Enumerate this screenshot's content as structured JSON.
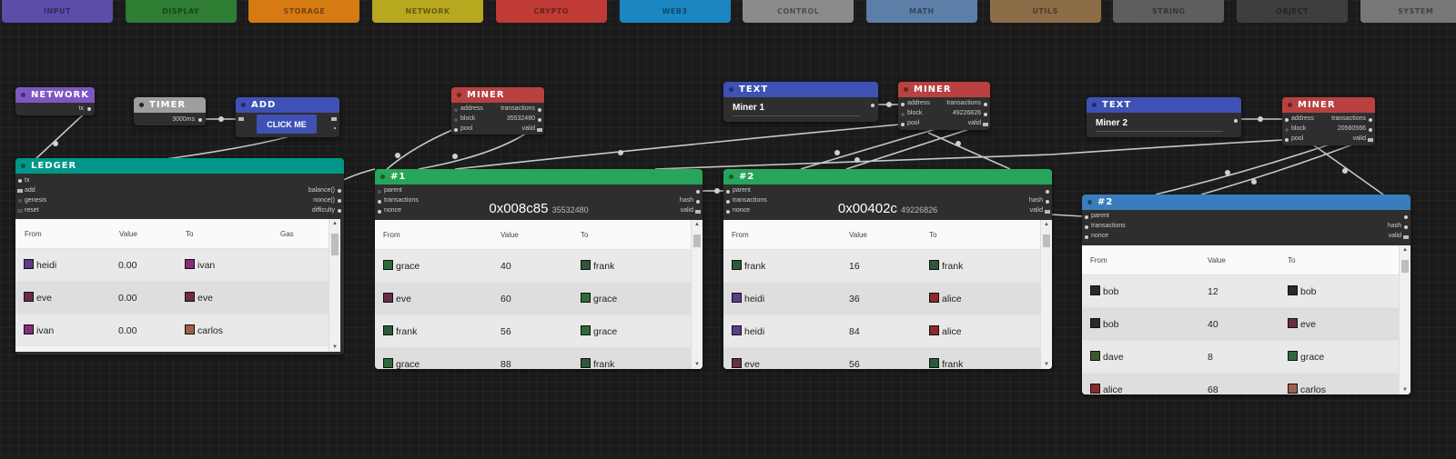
{
  "categories": [
    {
      "label": "INPUT",
      "color": "#5c4ea8"
    },
    {
      "label": "DISPLAY",
      "color": "#2e7d32"
    },
    {
      "label": "STORAGE",
      "color": "#d67a14"
    },
    {
      "label": "NETWORK",
      "color": "#b7a81f"
    },
    {
      "label": "CRYPTO",
      "color": "#c03a36"
    },
    {
      "label": "WEB3",
      "color": "#1b86c2"
    },
    {
      "label": "CONTROL",
      "color": "#8b8b8b"
    },
    {
      "label": "MATH",
      "color": "#5d7ea6"
    },
    {
      "label": "UTILS",
      "color": "#8c6d48"
    },
    {
      "label": "STRING",
      "color": "#5e5e5e"
    },
    {
      "label": "OBJECT",
      "color": "#3e3e3e"
    },
    {
      "label": "SYSTEM",
      "color": "#777777"
    }
  ],
  "network": {
    "title": "NETWORK",
    "port_tx": "tx"
  },
  "timer": {
    "title": "TIMER",
    "value": "3000ms"
  },
  "add": {
    "title": "ADD",
    "button": "CLICK ME"
  },
  "ledger": {
    "title": "LEDGER",
    "inputs": [
      "tx",
      "add",
      "genesis",
      "reset"
    ],
    "outputs": [
      "balance()",
      "nonce()",
      "difficulty"
    ],
    "columns": [
      "From",
      "Value",
      "To",
      "Gas"
    ],
    "rows": [
      {
        "from": "heidi",
        "value": "0.00",
        "to": "ivan"
      },
      {
        "from": "eve",
        "value": "0.00",
        "to": "eve"
      },
      {
        "from": "ivan",
        "value": "0.00",
        "to": "carlos"
      }
    ]
  },
  "miner1": {
    "title": "MINER",
    "address": "address",
    "block": "block",
    "block_val": "35532480",
    "pool": "pool",
    "transactions": "transactions",
    "valid": "valid"
  },
  "miner2": {
    "title": "MINER",
    "address": "address",
    "block": "block",
    "block_val": "49226826",
    "pool": "pool",
    "transactions": "transactions",
    "valid": "valid"
  },
  "miner3": {
    "title": "MINER",
    "address": "address",
    "block": "block",
    "block_val": "20560566",
    "pool": "pool",
    "transactions": "transactions",
    "valid": "valid"
  },
  "text1": {
    "title": "TEXT",
    "value": "Miner 1"
  },
  "text2": {
    "title": "TEXT",
    "value": "Miner 2"
  },
  "block1": {
    "title": "#1",
    "hash": "0x008c85",
    "nonce": "35532480",
    "inputs": [
      "parent",
      "transactions",
      "nonce"
    ],
    "outputs": [
      "hash",
      "valid"
    ],
    "columns": [
      "From",
      "Value",
      "To"
    ],
    "rows": [
      {
        "from": "grace",
        "value": "40",
        "to": "frank"
      },
      {
        "from": "eve",
        "value": "60",
        "to": "grace"
      },
      {
        "from": "frank",
        "value": "56",
        "to": "grace"
      },
      {
        "from": "grace",
        "value": "88",
        "to": "frank"
      }
    ]
  },
  "block2": {
    "title": "#2",
    "hash": "0x00402c",
    "nonce": "49226826",
    "inputs": [
      "parent",
      "transactions",
      "nonce"
    ],
    "outputs": [
      "hash",
      "valid"
    ],
    "columns": [
      "From",
      "Value",
      "To"
    ],
    "rows": [
      {
        "from": "frank",
        "value": "16",
        "to": "frank"
      },
      {
        "from": "heidi",
        "value": "36",
        "to": "alice"
      },
      {
        "from": "heidi",
        "value": "84",
        "to": "alice"
      },
      {
        "from": "eve",
        "value": "56",
        "to": "frank"
      }
    ]
  },
  "block3": {
    "title": "#2",
    "inputs": [
      "parent",
      "transactions",
      "nonce"
    ],
    "outputs": [
      "hash",
      "valid"
    ],
    "columns": [
      "From",
      "Value",
      "To"
    ],
    "rows": [
      {
        "from": "bob",
        "value": "12",
        "to": "bob"
      },
      {
        "from": "bob",
        "value": "40",
        "to": "eve"
      },
      {
        "from": "dave",
        "value": "8",
        "to": "grace"
      },
      {
        "from": "alice",
        "value": "68",
        "to": "carlos"
      }
    ]
  },
  "avatar_colors": {
    "heidi": "#5a3d8a",
    "eve": "#6b2b4a",
    "ivan": "#8a2a7a",
    "carlos": "#a0604a",
    "grace": "#2f6a3a",
    "frank": "#2a5a3a",
    "alice": "#8a2a2a",
    "bob": "#2a2a2a",
    "dave": "#3a5a2a"
  },
  "colors": {
    "network": "#7e57c2",
    "timer": "#9e9e9e",
    "add": "#3f51b5",
    "ledger": "#009688",
    "miner": "#b94141",
    "text": "#3f51b5",
    "block_green": "#27a55a",
    "block_blue": "#3a7dbe"
  }
}
